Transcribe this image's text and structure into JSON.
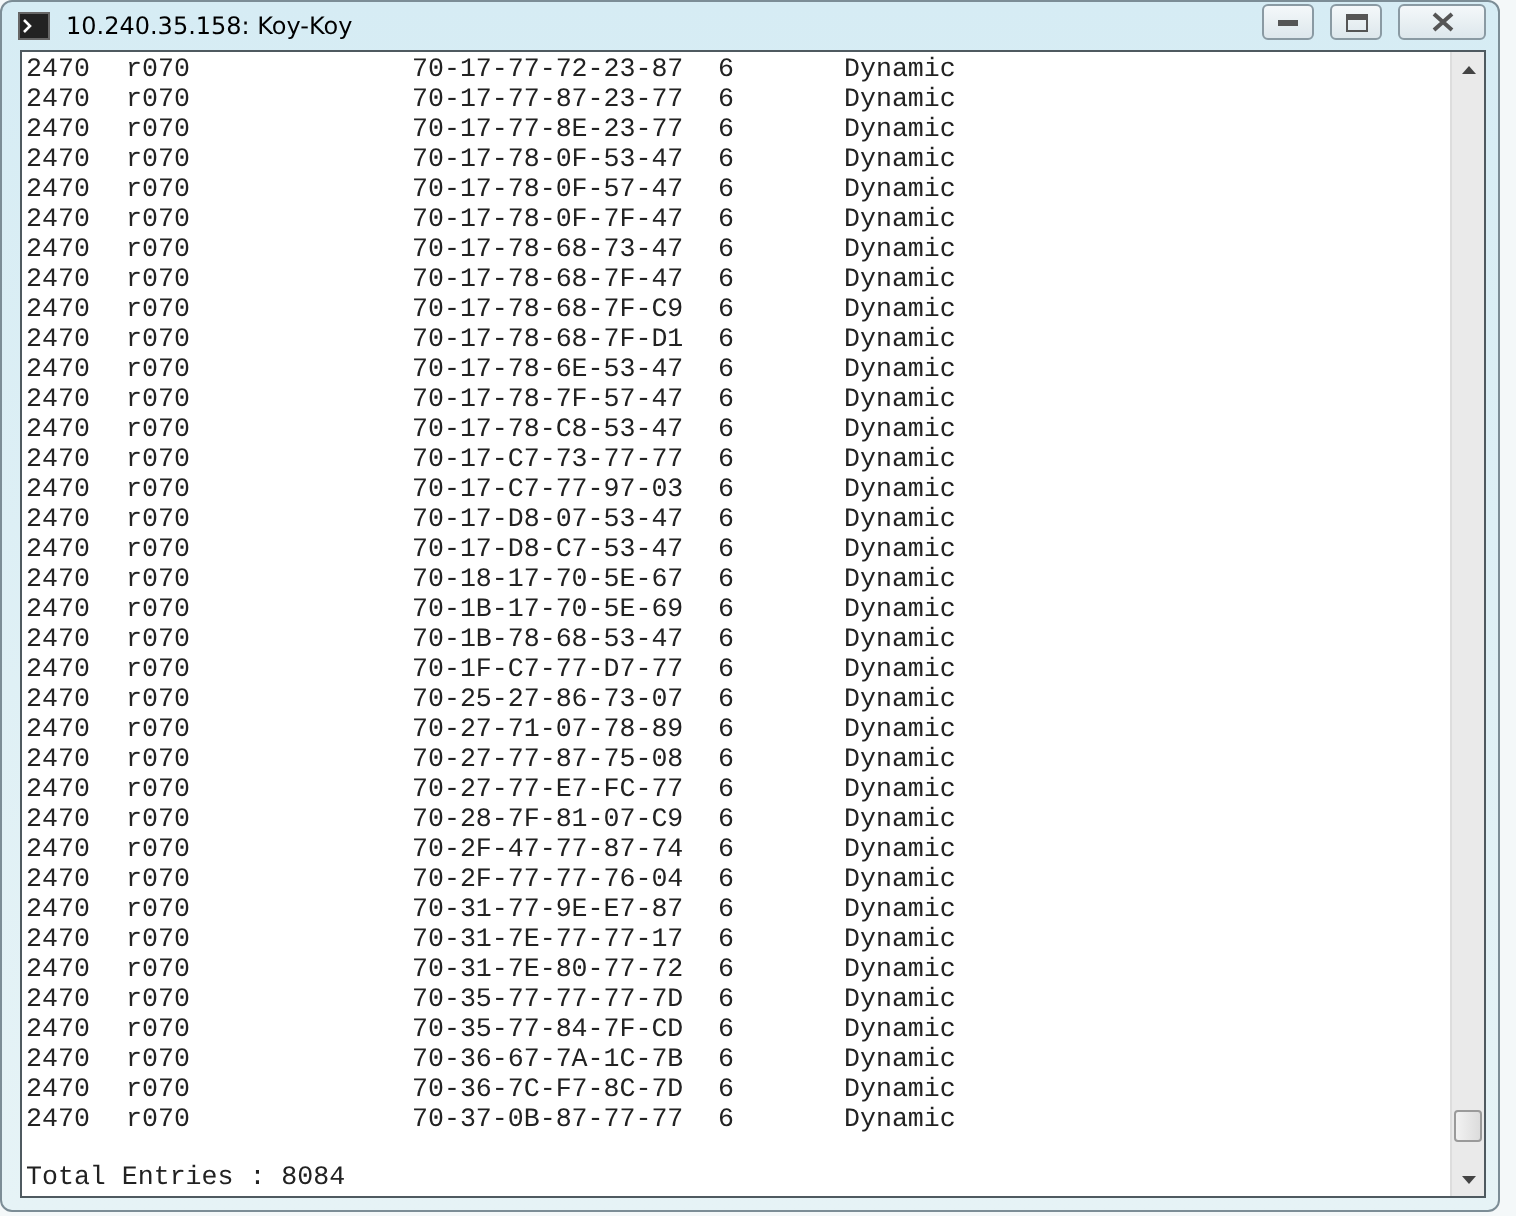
{
  "window": {
    "title": "10.240.35.158: Koy-Koy"
  },
  "rows": [
    {
      "vlan": "2470",
      "name": "r070",
      "mac": "70-17-77-72-23-87",
      "port": "6",
      "type": "Dynamic"
    },
    {
      "vlan": "2470",
      "name": "r070",
      "mac": "70-17-77-87-23-77",
      "port": "6",
      "type": "Dynamic"
    },
    {
      "vlan": "2470",
      "name": "r070",
      "mac": "70-17-77-8E-23-77",
      "port": "6",
      "type": "Dynamic"
    },
    {
      "vlan": "2470",
      "name": "r070",
      "mac": "70-17-78-0F-53-47",
      "port": "6",
      "type": "Dynamic"
    },
    {
      "vlan": "2470",
      "name": "r070",
      "mac": "70-17-78-0F-57-47",
      "port": "6",
      "type": "Dynamic"
    },
    {
      "vlan": "2470",
      "name": "r070",
      "mac": "70-17-78-0F-7F-47",
      "port": "6",
      "type": "Dynamic"
    },
    {
      "vlan": "2470",
      "name": "r070",
      "mac": "70-17-78-68-73-47",
      "port": "6",
      "type": "Dynamic"
    },
    {
      "vlan": "2470",
      "name": "r070",
      "mac": "70-17-78-68-7F-47",
      "port": "6",
      "type": "Dynamic"
    },
    {
      "vlan": "2470",
      "name": "r070",
      "mac": "70-17-78-68-7F-C9",
      "port": "6",
      "type": "Dynamic"
    },
    {
      "vlan": "2470",
      "name": "r070",
      "mac": "70-17-78-68-7F-D1",
      "port": "6",
      "type": "Dynamic"
    },
    {
      "vlan": "2470",
      "name": "r070",
      "mac": "70-17-78-6E-53-47",
      "port": "6",
      "type": "Dynamic"
    },
    {
      "vlan": "2470",
      "name": "r070",
      "mac": "70-17-78-7F-57-47",
      "port": "6",
      "type": "Dynamic"
    },
    {
      "vlan": "2470",
      "name": "r070",
      "mac": "70-17-78-C8-53-47",
      "port": "6",
      "type": "Dynamic"
    },
    {
      "vlan": "2470",
      "name": "r070",
      "mac": "70-17-C7-73-77-77",
      "port": "6",
      "type": "Dynamic"
    },
    {
      "vlan": "2470",
      "name": "r070",
      "mac": "70-17-C7-77-97-03",
      "port": "6",
      "type": "Dynamic"
    },
    {
      "vlan": "2470",
      "name": "r070",
      "mac": "70-17-D8-07-53-47",
      "port": "6",
      "type": "Dynamic"
    },
    {
      "vlan": "2470",
      "name": "r070",
      "mac": "70-17-D8-C7-53-47",
      "port": "6",
      "type": "Dynamic"
    },
    {
      "vlan": "2470",
      "name": "r070",
      "mac": "70-18-17-70-5E-67",
      "port": "6",
      "type": "Dynamic"
    },
    {
      "vlan": "2470",
      "name": "r070",
      "mac": "70-1B-17-70-5E-69",
      "port": "6",
      "type": "Dynamic"
    },
    {
      "vlan": "2470",
      "name": "r070",
      "mac": "70-1B-78-68-53-47",
      "port": "6",
      "type": "Dynamic"
    },
    {
      "vlan": "2470",
      "name": "r070",
      "mac": "70-1F-C7-77-D7-77",
      "port": "6",
      "type": "Dynamic"
    },
    {
      "vlan": "2470",
      "name": "r070",
      "mac": "70-25-27-86-73-07",
      "port": "6",
      "type": "Dynamic"
    },
    {
      "vlan": "2470",
      "name": "r070",
      "mac": "70-27-71-07-78-89",
      "port": "6",
      "type": "Dynamic"
    },
    {
      "vlan": "2470",
      "name": "r070",
      "mac": "70-27-77-87-75-08",
      "port": "6",
      "type": "Dynamic"
    },
    {
      "vlan": "2470",
      "name": "r070",
      "mac": "70-27-77-E7-FC-77",
      "port": "6",
      "type": "Dynamic"
    },
    {
      "vlan": "2470",
      "name": "r070",
      "mac": "70-28-7F-81-07-C9",
      "port": "6",
      "type": "Dynamic"
    },
    {
      "vlan": "2470",
      "name": "r070",
      "mac": "70-2F-47-77-87-74",
      "port": "6",
      "type": "Dynamic"
    },
    {
      "vlan": "2470",
      "name": "r070",
      "mac": "70-2F-77-77-76-04",
      "port": "6",
      "type": "Dynamic"
    },
    {
      "vlan": "2470",
      "name": "r070",
      "mac": "70-31-77-9E-E7-87",
      "port": "6",
      "type": "Dynamic"
    },
    {
      "vlan": "2470",
      "name": "r070",
      "mac": "70-31-7E-77-77-17",
      "port": "6",
      "type": "Dynamic"
    },
    {
      "vlan": "2470",
      "name": "r070",
      "mac": "70-31-7E-80-77-72",
      "port": "6",
      "type": "Dynamic"
    },
    {
      "vlan": "2470",
      "name": "r070",
      "mac": "70-35-77-77-77-7D",
      "port": "6",
      "type": "Dynamic"
    },
    {
      "vlan": "2470",
      "name": "r070",
      "mac": "70-35-77-84-7F-CD",
      "port": "6",
      "type": "Dynamic"
    },
    {
      "vlan": "2470",
      "name": "r070",
      "mac": "70-36-67-7A-1C-7B",
      "port": "6",
      "type": "Dynamic"
    },
    {
      "vlan": "2470",
      "name": "r070",
      "mac": "70-36-7C-F7-8C-7D",
      "port": "6",
      "type": "Dynamic"
    },
    {
      "vlan": "2470",
      "name": "r070",
      "mac": "70-37-0B-87-77-77",
      "port": "6",
      "type": "Dynamic"
    }
  ],
  "footer": "Total Entries : 8084"
}
